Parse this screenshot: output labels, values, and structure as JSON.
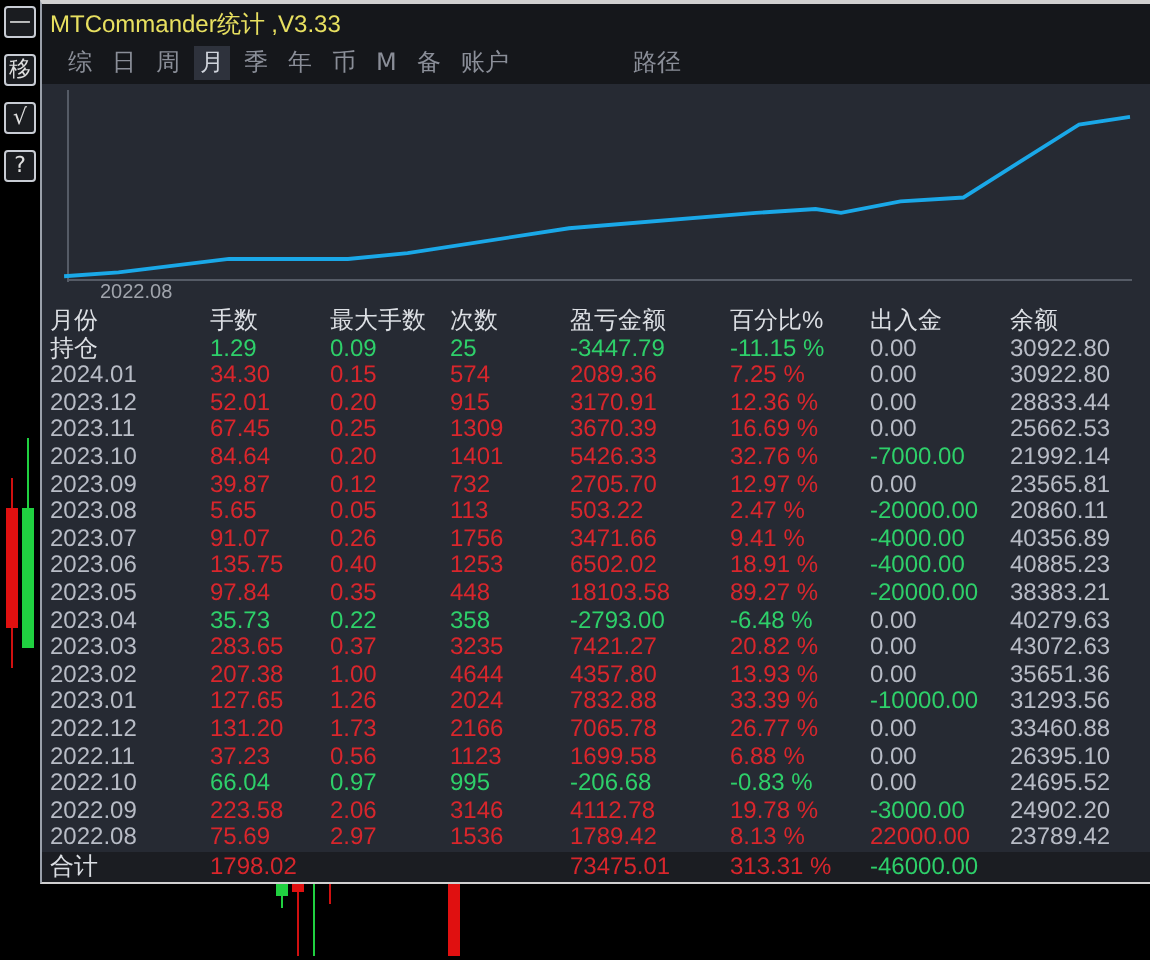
{
  "window": {
    "title": "MTCommander统计 ,V3.33"
  },
  "side_buttons": [
    {
      "label": "—"
    },
    {
      "label": "移"
    },
    {
      "label": "√"
    },
    {
      "label": "?"
    }
  ],
  "tabs": [
    {
      "label": "综",
      "selected": false
    },
    {
      "label": "日",
      "selected": false
    },
    {
      "label": "周",
      "selected": false
    },
    {
      "label": "月",
      "selected": true
    },
    {
      "label": "季",
      "selected": false
    },
    {
      "label": "年",
      "selected": false
    },
    {
      "label": "币",
      "selected": false
    },
    {
      "label": "M",
      "selected": false
    },
    {
      "label": "备",
      "selected": false
    },
    {
      "label": "账户",
      "selected": false
    },
    {
      "label": "路径",
      "selected": false
    }
  ],
  "chart": {
    "start_label": "2022.08"
  },
  "table": {
    "columns": [
      "月份",
      "手数",
      "最大手数",
      "次数",
      "盈亏金额",
      "百分比%",
      "出入金",
      "余额"
    ],
    "rows": [
      {
        "color": "#2ed06a",
        "deposit": {
          "color": "#b8bcc6"
        },
        "cells": [
          "持仓",
          "1.29",
          "0.09",
          "25",
          "-3447.79",
          "-11.15 %",
          "0.00",
          "30922.80"
        ]
      },
      {
        "color": "#d8262c",
        "deposit": {
          "color": "#b8bcc6"
        },
        "cells": [
          "2024.01",
          "34.30",
          "0.15",
          "574",
          "2089.36",
          "7.25 %",
          "0.00",
          "30922.80"
        ]
      },
      {
        "color": "#d8262c",
        "deposit": {
          "color": "#b8bcc6"
        },
        "cells": [
          "2023.12",
          "52.01",
          "0.20",
          "915",
          "3170.91",
          "12.36 %",
          "0.00",
          "28833.44"
        ]
      },
      {
        "color": "#d8262c",
        "deposit": {
          "color": "#b8bcc6"
        },
        "cells": [
          "2023.11",
          "67.45",
          "0.25",
          "1309",
          "3670.39",
          "16.69 %",
          "0.00",
          "25662.53"
        ]
      },
      {
        "color": "#d8262c",
        "deposit": {
          "color": "#2ed06a"
        },
        "cells": [
          "2023.10",
          "84.64",
          "0.20",
          "1401",
          "5426.33",
          "32.76 %",
          "-7000.00",
          "21992.14"
        ]
      },
      {
        "color": "#d8262c",
        "deposit": {
          "color": "#b8bcc6"
        },
        "cells": [
          "2023.09",
          "39.87",
          "0.12",
          "732",
          "2705.70",
          "12.97 %",
          "0.00",
          "23565.81"
        ]
      },
      {
        "color": "#d8262c",
        "deposit": {
          "color": "#2ed06a"
        },
        "cells": [
          "2023.08",
          "5.65",
          "0.05",
          "113",
          "503.22",
          "2.47 %",
          "-20000.00",
          "20860.11"
        ]
      },
      {
        "color": "#d8262c",
        "deposit": {
          "color": "#2ed06a"
        },
        "cells": [
          "2023.07",
          "91.07",
          "0.26",
          "1756",
          "3471.66",
          "9.41 %",
          "-4000.00",
          "40356.89"
        ]
      },
      {
        "color": "#d8262c",
        "deposit": {
          "color": "#2ed06a"
        },
        "cells": [
          "2023.06",
          "135.75",
          "0.40",
          "1253",
          "6502.02",
          "18.91 %",
          "-4000.00",
          "40885.23"
        ]
      },
      {
        "color": "#d8262c",
        "deposit": {
          "color": "#2ed06a"
        },
        "cells": [
          "2023.05",
          "97.84",
          "0.35",
          "448",
          "18103.58",
          "89.27 %",
          "-20000.00",
          "38383.21"
        ]
      },
      {
        "color": "#2ed06a",
        "deposit": {
          "color": "#b8bcc6"
        },
        "cells": [
          "2023.04",
          "35.73",
          "0.22",
          "358",
          "-2793.00",
          "-6.48 %",
          "0.00",
          "40279.63"
        ]
      },
      {
        "color": "#d8262c",
        "deposit": {
          "color": "#b8bcc6"
        },
        "cells": [
          "2023.03",
          "283.65",
          "0.37",
          "3235",
          "7421.27",
          "20.82 %",
          "0.00",
          "43072.63"
        ]
      },
      {
        "color": "#d8262c",
        "deposit": {
          "color": "#b8bcc6"
        },
        "cells": [
          "2023.02",
          "207.38",
          "1.00",
          "4644",
          "4357.80",
          "13.93 %",
          "0.00",
          "35651.36"
        ]
      },
      {
        "color": "#d8262c",
        "deposit": {
          "color": "#2ed06a"
        },
        "cells": [
          "2023.01",
          "127.65",
          "1.26",
          "2024",
          "7832.88",
          "33.39 %",
          "-10000.00",
          "31293.56"
        ]
      },
      {
        "color": "#d8262c",
        "deposit": {
          "color": "#b8bcc6"
        },
        "cells": [
          "2022.12",
          "131.20",
          "1.73",
          "2166",
          "7065.78",
          "26.77 %",
          "0.00",
          "33460.88"
        ]
      },
      {
        "color": "#d8262c",
        "deposit": {
          "color": "#b8bcc6"
        },
        "cells": [
          "2022.11",
          "37.23",
          "0.56",
          "1123",
          "1699.58",
          "6.88 %",
          "0.00",
          "26395.10"
        ]
      },
      {
        "color": "#2ed06a",
        "deposit": {
          "color": "#b8bcc6"
        },
        "cells": [
          "2022.10",
          "66.04",
          "0.97",
          "995",
          "-206.68",
          "-0.83 %",
          "0.00",
          "24695.52"
        ]
      },
      {
        "color": "#d8262c",
        "deposit": {
          "color": "#2ed06a"
        },
        "cells": [
          "2022.09",
          "223.58",
          "2.06",
          "3146",
          "4112.78",
          "19.78 %",
          "-3000.00",
          "24902.20"
        ]
      },
      {
        "color": "#d8262c",
        "deposit": {
          "color": "#d8262c"
        },
        "cells": [
          "2022.08",
          "75.69",
          "2.97",
          "1536",
          "1789.42",
          "8.13 %",
          "22000.00",
          "23789.42"
        ]
      }
    ],
    "total": {
      "color": "#d8262c",
      "deposit": {
        "color": "#2ed06a"
      },
      "cells": [
        "合计",
        "1798.02",
        "",
        "",
        "73475.01",
        "313.31 %",
        "-46000.00",
        ""
      ]
    }
  }
}
